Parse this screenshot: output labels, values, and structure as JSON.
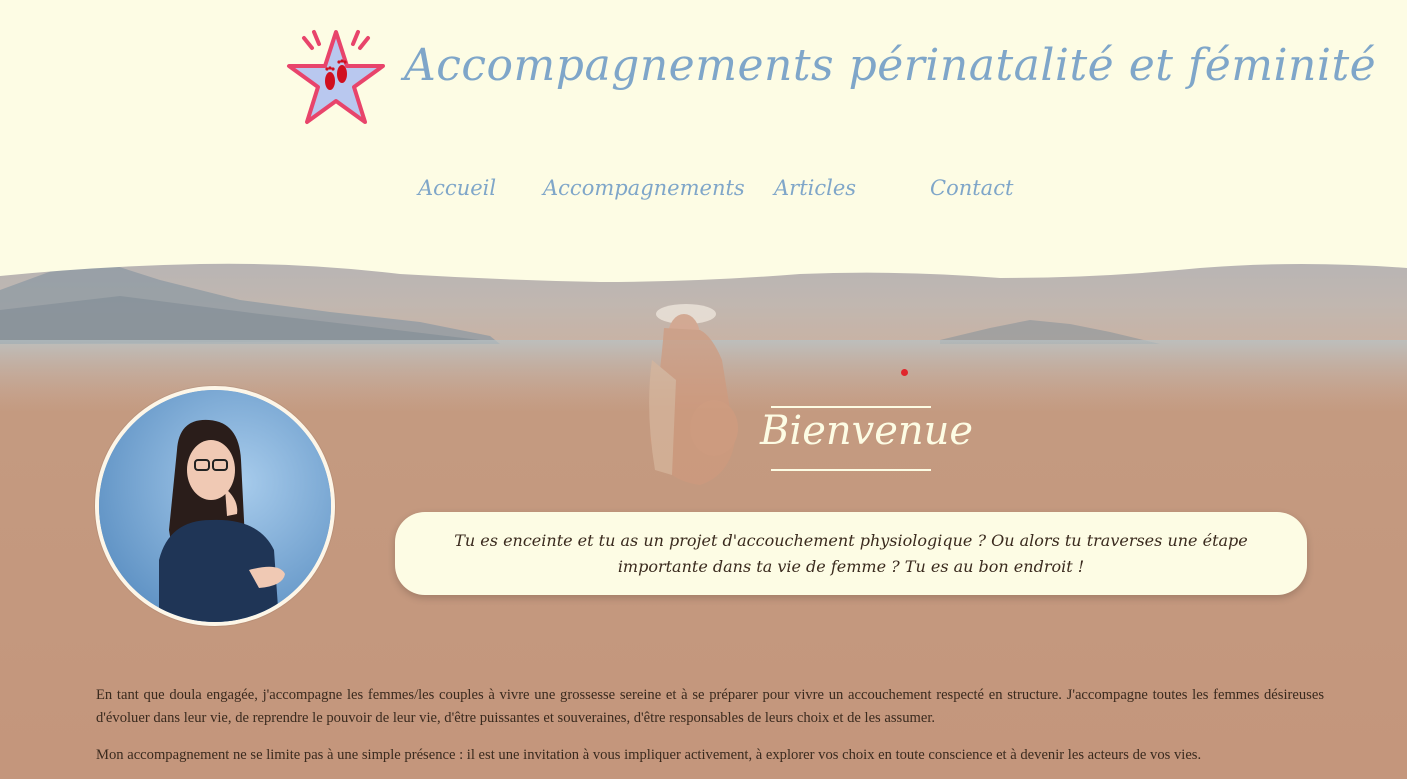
{
  "site": {
    "title": "Accompagnements périnatalité et féminité",
    "logo_icon": "star-footprints-icon"
  },
  "nav": {
    "items": [
      {
        "label": "Accueil"
      },
      {
        "label": "Accompagnements"
      },
      {
        "label": "Articles"
      },
      {
        "label": "Contact"
      }
    ]
  },
  "hero": {
    "welcome_title": "Bienvenue",
    "intro": "Tu es enceinte et tu as un projet d'accouchement physiologique ? Ou alors tu traverses une étape importante dans ta vie de femme ? Tu es au bon endroit !"
  },
  "content": {
    "paragraph_1": "En tant que doula engagée, j'accompagne les femmes/les couples à vivre une grossesse sereine et à se préparer pour vivre un accouchement respecté en structure. J'accompagne toutes les femmes désireuses d'évoluer dans leur vie, de reprendre le pouvoir de leur vie, d'être puissantes et souveraines, d'être responsables de leurs choix et de les assumer.",
    "paragraph_2": "Mon accompagnement ne se limite pas à une simple présence : il est une invitation à vous impliquer activement, à explorer vos choix en toute conscience et à devenir les acteurs de vos vies."
  },
  "colors": {
    "background": "#fdfce4",
    "accent_blue": "#7fa6c9",
    "hero_warm": "#c4967c",
    "logo_pink": "#e8446b",
    "logo_fill": "#b9c8ef",
    "feet_red": "#d0101f"
  }
}
